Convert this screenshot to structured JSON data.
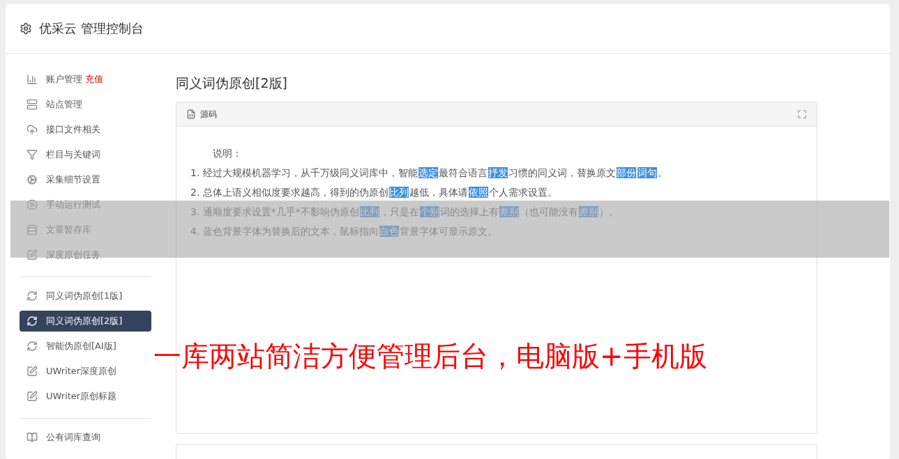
{
  "header": {
    "title": "优采云 管理控制台"
  },
  "sidebar": {
    "groups": [
      {
        "items": [
          {
            "label": "账户管理",
            "badge": "充值",
            "selected": false
          },
          {
            "label": "站点管理",
            "selected": false
          },
          {
            "label": "接口文件相关",
            "selected": false
          },
          {
            "label": "栏目与关键词",
            "selected": false
          },
          {
            "label": "采集细节设置",
            "selected": false
          },
          {
            "label": "手动运行测试",
            "selected": false
          },
          {
            "label": "文章暂存库",
            "selected": false
          },
          {
            "label": "深度原创任务",
            "selected": false
          }
        ]
      },
      {
        "items": [
          {
            "label": "同义词伪原创[1版]",
            "selected": false
          },
          {
            "label": "同义词伪原创[2版]",
            "selected": true
          },
          {
            "label": "智能伪原创[AI版]",
            "selected": false
          },
          {
            "label": "UWriter深度原创",
            "selected": false
          },
          {
            "label": "UWriter原创标题",
            "selected": false
          }
        ]
      },
      {
        "items": [
          {
            "label": "公有词库查询",
            "selected": false
          }
        ]
      }
    ]
  },
  "content": {
    "title": "同义词伪原创[2版]",
    "panel": {
      "tab": "源码",
      "heading": "说明：",
      "lines": [
        [
          {
            "text": "1. 经过大规模机器学习，从千万级同义词库中，智能",
            "highlighted": false
          },
          {
            "text": "选定",
            "highlighted": true
          },
          {
            "text": "最符合语言",
            "highlighted": false
          },
          {
            "text": "抒发",
            "highlighted": true
          },
          {
            "text": "习惯的同义词，替换原文",
            "highlighted": false
          },
          {
            "text": "部份",
            "highlighted": true
          },
          {
            "text": "词句",
            "highlighted": true
          },
          {
            "text": "。",
            "highlighted": false
          }
        ],
        [
          {
            "text": "2. 总体上语义相似度要求越高，得到的伪原创",
            "highlighted": false
          },
          {
            "text": "比列",
            "highlighted": true
          },
          {
            "text": "越低，具体请",
            "highlighted": false
          },
          {
            "text": "依照",
            "highlighted": true
          },
          {
            "text": "个人需求设置。",
            "highlighted": false
          }
        ],
        [
          {
            "text": "3. 通顺度要求设置*几乎*不影响伪原创",
            "highlighted": false
          },
          {
            "text": "比列",
            "highlighted": true
          },
          {
            "text": "，只是在",
            "highlighted": false
          },
          {
            "text": "个别",
            "highlighted": true
          },
          {
            "text": "词的选择上有",
            "highlighted": false
          },
          {
            "text": "差别",
            "highlighted": true
          },
          {
            "text": "（也可能没有",
            "highlighted": false
          },
          {
            "text": "差别",
            "highlighted": true
          },
          {
            "text": "）。",
            "highlighted": false
          }
        ],
        [
          {
            "text": "4. 蓝色背景字体为替换后的文本，鼠标指向",
            "highlighted": false
          },
          {
            "text": "白色",
            "highlighted": true
          },
          {
            "text": "背景字体可显示原文。",
            "highlighted": false
          }
        ]
      ]
    }
  },
  "overlay": {
    "caption": "一库两站简洁方便管理后台，电脑版+手机版"
  }
}
